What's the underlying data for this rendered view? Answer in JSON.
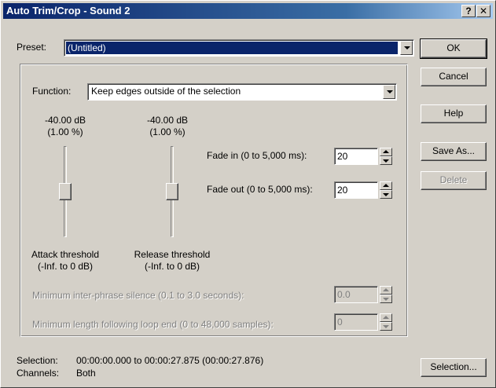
{
  "window": {
    "title": "Auto Trim/Crop - Sound 2",
    "help_glyph": "?",
    "close_glyph": "✕"
  },
  "preset": {
    "label": "Preset:",
    "value": "(Untitled)"
  },
  "buttons": {
    "ok": "OK",
    "cancel": "Cancel",
    "help": "Help",
    "save_as": "Save As...",
    "delete": "Delete",
    "selection": "Selection..."
  },
  "function": {
    "label": "Function:",
    "value": "Keep edges outside of the selection"
  },
  "attack": {
    "db": "-40.00 dB",
    "pct": "(1.00 %)",
    "label": "Attack threshold",
    "range": "(-Inf. to 0 dB)",
    "slider_fraction": 0.5
  },
  "release": {
    "db": "-40.00 dB",
    "pct": "(1.00 %)",
    "label": "Release threshold",
    "range": "(-Inf. to 0 dB)",
    "slider_fraction": 0.5
  },
  "fade_in": {
    "label": "Fade in (0 to 5,000 ms):",
    "value": "20"
  },
  "fade_out": {
    "label": "Fade out (0 to 5,000 ms):",
    "value": "20"
  },
  "min_silence": {
    "label": "Minimum inter-phrase silence (0.1 to 3.0 seconds):",
    "value": "0.0"
  },
  "min_length": {
    "label": "Minimum length following loop end (0 to 48,000 samples):",
    "value": "0"
  },
  "status": {
    "selection_label": "Selection:",
    "selection_value": "00:00:00.000 to 00:00:27.875 (00:00:27.876)",
    "channels_label": "Channels:",
    "channels_value": "Both"
  },
  "colors": {
    "title_bar": "#0a246a",
    "face": "#d4d0c8",
    "highlight": "#0a246a"
  }
}
